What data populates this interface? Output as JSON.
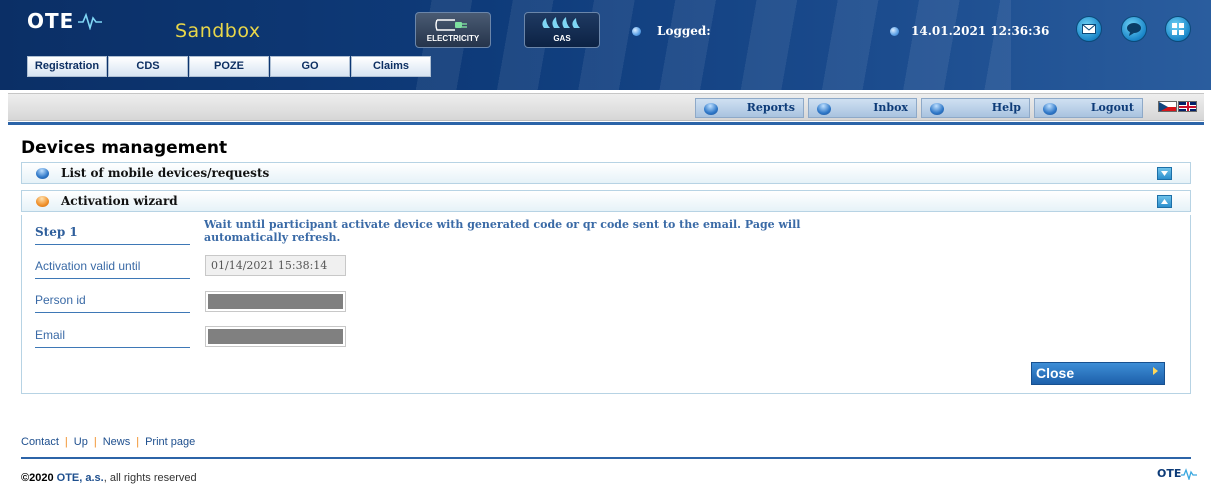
{
  "header": {
    "logo_text": "OTE",
    "environment": "Sandbox",
    "segments": [
      {
        "label": "ELECTRICITY",
        "icon": "electric-plug-icon"
      },
      {
        "label": "GAS",
        "icon": "gas-flame-icon"
      }
    ],
    "logged_label": "Logged:",
    "datetime": "14.01.2021 12:36:36",
    "action_icons": [
      "mail-icon",
      "chat-icon",
      "windows-icon"
    ],
    "nav_tabs": [
      "Registration",
      "CDS",
      "POZE",
      "GO",
      "Claims"
    ]
  },
  "toolbar": {
    "buttons": [
      "Reports",
      "Inbox",
      "Help",
      "Logout"
    ],
    "languages": [
      "cz-flag-icon",
      "uk-flag-icon"
    ]
  },
  "page": {
    "title": "Devices management",
    "panels": [
      {
        "title": "List of mobile devices/requests",
        "state": "collapsed"
      },
      {
        "title": "Activation wizard",
        "state": "expanded"
      }
    ],
    "wizard": {
      "step_label": "Step 1",
      "message": "Wait until participant activate device with generated code or qr code sent to the email. Page will automatically refresh.",
      "fields": [
        {
          "label": "Activation valid until",
          "value": "01/14/2021 15:38:14"
        },
        {
          "label": "Person id",
          "value": ""
        },
        {
          "label": "Email",
          "value": ""
        }
      ],
      "close_label": "Close"
    }
  },
  "footer": {
    "links": [
      "Contact",
      "Up",
      "News",
      "Print page"
    ],
    "copyright_year": "©2020",
    "copyright_org": "OTE, a.s.",
    "copyright_rest": ", all rights reserved",
    "logo_text": "OTE"
  },
  "colors": {
    "header_bg": "#0e3b7a",
    "accent_blue": "#2c64a8",
    "label_blue": "#3a6aa6",
    "env_yellow": "#e8d64a",
    "orange": "#f0902a"
  }
}
